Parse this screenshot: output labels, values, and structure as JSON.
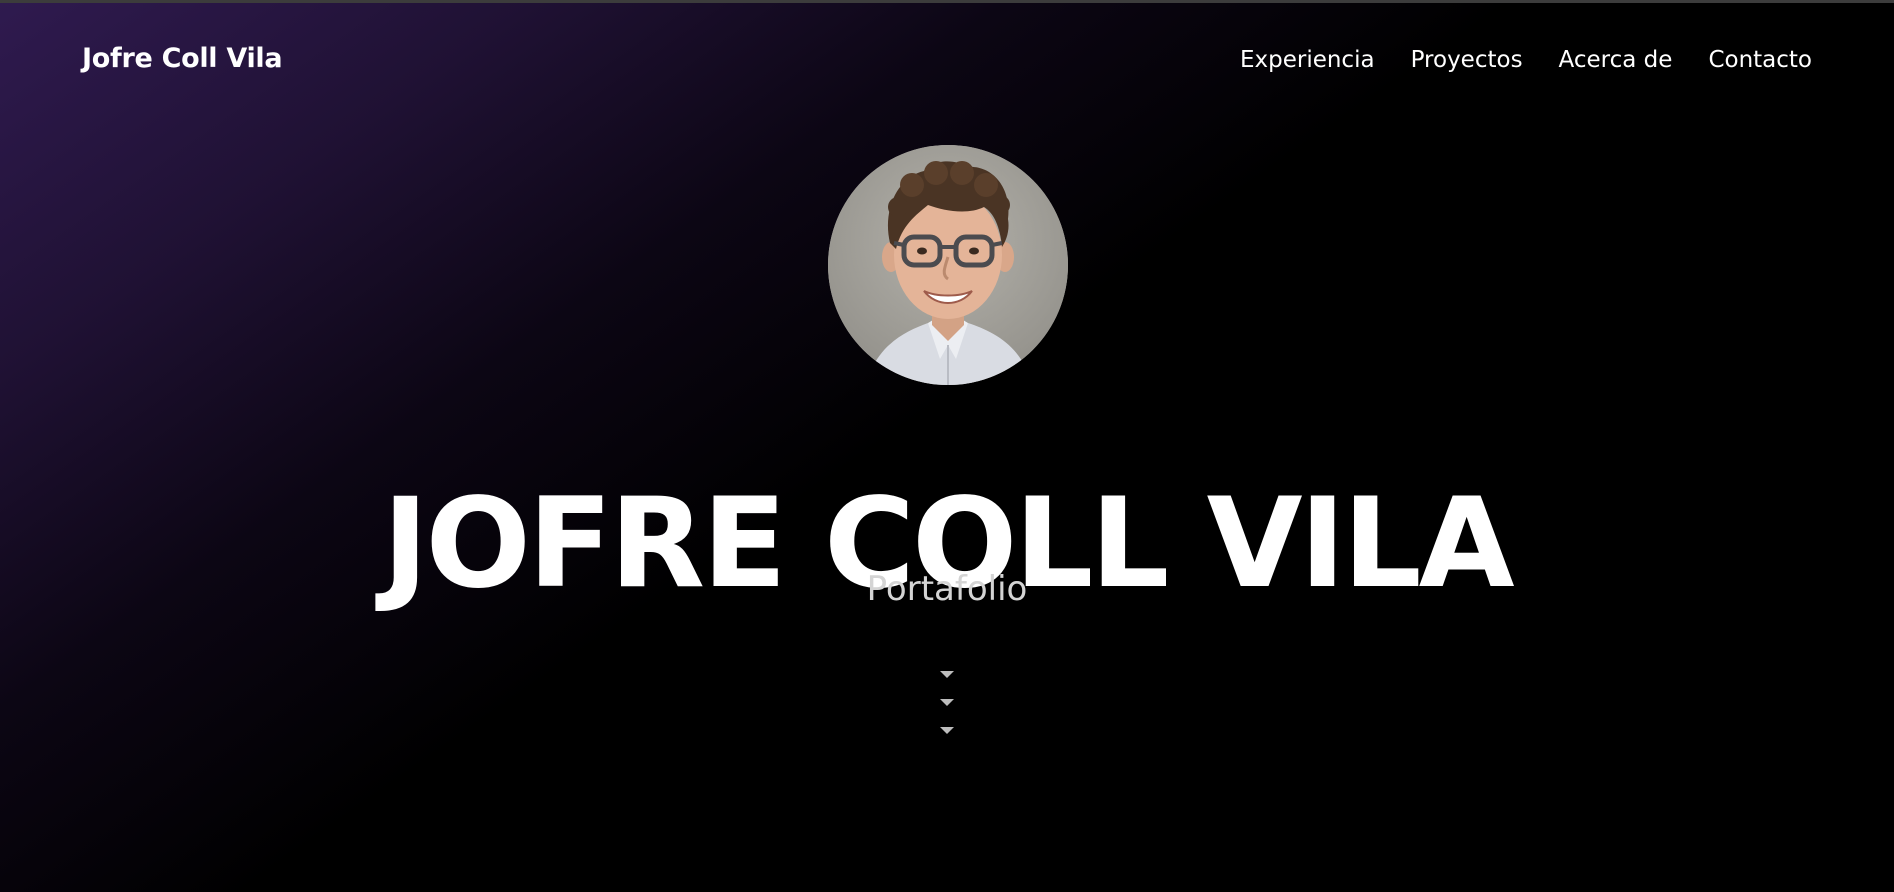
{
  "header": {
    "brand": "Jofre Coll Vila",
    "nav": [
      {
        "label": "Experiencia"
      },
      {
        "label": "Proyectos"
      },
      {
        "label": "Acerca de"
      },
      {
        "label": "Contacto"
      }
    ]
  },
  "hero": {
    "avatar_alt": "Jofre Coll Vila",
    "title": "JOFRE COLL VILA",
    "subtitle": "Portafolio",
    "scroll_icon": "chevron-down-icon"
  },
  "colors": {
    "background": "#000000",
    "gradient_accent": "#2f1a4f",
    "text": "#ffffff",
    "subtitle": "#d4d4d4"
  }
}
